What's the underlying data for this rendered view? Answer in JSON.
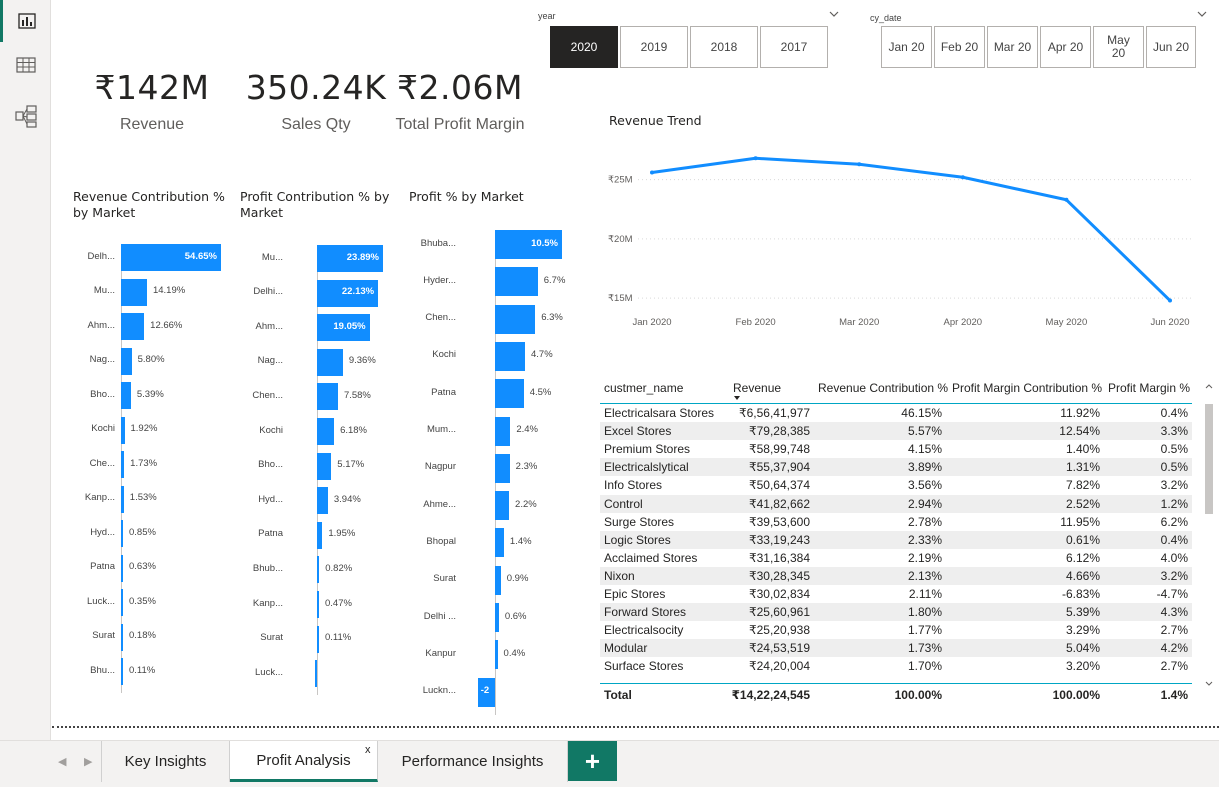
{
  "colors": {
    "accent": "#118dff",
    "tab_accent": "#117865",
    "selected_tile": "#252423",
    "line": "#118dff"
  },
  "rail": {
    "icons": [
      "report-icon",
      "table-icon",
      "model-icon"
    ]
  },
  "slicers": {
    "year": {
      "title": "year",
      "options": [
        "2020",
        "2019",
        "2018",
        "2017"
      ],
      "selected": "2020"
    },
    "cy_date": {
      "title": "cy_date",
      "options": [
        "Jan 20",
        "Feb 20",
        "Mar 20",
        "Apr 20",
        "May 20",
        "Jun 20"
      ]
    }
  },
  "kpis": [
    {
      "value": "₹142M",
      "label": "Revenue"
    },
    {
      "value": "350.24K",
      "label": "Sales Qty"
    },
    {
      "value": "₹2.06M",
      "label": "Total Profit Margin"
    }
  ],
  "bar_charts": [
    {
      "title_line1": "Revenue Contribution %",
      "title_line2": "by Market",
      "categories": [
        "Delh...",
        "Mu...",
        "Ahm...",
        "Nag...",
        "Bho...",
        "Kochi",
        "Che...",
        "Kanp...",
        "Hyd...",
        "Patna",
        "Luck...",
        "Surat",
        "Bhu..."
      ],
      "values": [
        54.65,
        14.19,
        12.66,
        5.8,
        5.39,
        1.92,
        1.73,
        1.53,
        0.85,
        0.63,
        0.35,
        0.18,
        0.11
      ],
      "labels": [
        "54.65%",
        "14.19%",
        "12.66%",
        "5.80%",
        "5.39%",
        "1.92%",
        "1.73%",
        "1.53%",
        "0.85%",
        "0.63%",
        "0.35%",
        "0.18%",
        "0.11%"
      ]
    },
    {
      "title_line1": "Profit Contribution % by",
      "title_line2": "Market",
      "categories": [
        "Mu...",
        "Delhi...",
        "Ahm...",
        "Nag...",
        "Chen...",
        "Kochi",
        "Bho...",
        "Hyd...",
        "Patna",
        "Bhub...",
        "Kanp...",
        "Surat",
        "Luck..."
      ],
      "values": [
        23.89,
        22.13,
        19.05,
        9.36,
        7.58,
        6.18,
        5.17,
        3.94,
        1.95,
        0.82,
        0.47,
        0.11,
        -0.3
      ],
      "labels": [
        "23.89%",
        "22.13%",
        "19.05%",
        "9.36%",
        "7.58%",
        "6.18%",
        "5.17%",
        "3.94%",
        "1.95%",
        "0.82%",
        "0.47%",
        "0.11%",
        ""
      ]
    },
    {
      "title_line1": "Profit % by Market",
      "title_line2": "",
      "categories": [
        "Bhuba...",
        "Hyder...",
        "Chen...",
        "Kochi",
        "Patna",
        "Mum...",
        "Nagpur",
        "Ahme...",
        "Bhopal",
        "Surat",
        "Delhi ...",
        "Kanpur",
        "Luckn..."
      ],
      "values": [
        10.5,
        6.7,
        6.3,
        4.7,
        4.5,
        2.4,
        2.3,
        2.2,
        1.4,
        0.9,
        0.6,
        0.4,
        -2.7
      ],
      "labels": [
        "10.5%",
        "6.7%",
        "6.3%",
        "4.7%",
        "4.5%",
        "2.4%",
        "2.3%",
        "2.2%",
        "1.4%",
        "0.9%",
        "0.6%",
        "0.4%",
        "-2"
      ]
    }
  ],
  "chart_data": {
    "type": "line",
    "title": "Revenue Trend",
    "x": [
      "Jan 2020",
      "Feb 2020",
      "Mar 2020",
      "Apr 2020",
      "May 2020",
      "Jun 2020"
    ],
    "values": [
      25.6,
      26.8,
      26.3,
      25.2,
      23.3,
      14.8
    ],
    "y_ticks": [
      "₹15M",
      "₹20M",
      "₹25M"
    ],
    "ylim": [
      14,
      27.5
    ],
    "grid": true
  },
  "table": {
    "columns": [
      "custmer_name",
      "Revenue",
      "Revenue Contribution %",
      "Profit Margin Contribution %",
      "Profit Margin %"
    ],
    "rows": [
      [
        "Electricalsara Stores",
        "₹6,56,41,977",
        "46.15%",
        "11.92%",
        "0.4%"
      ],
      [
        "Excel Stores",
        "₹79,28,385",
        "5.57%",
        "12.54%",
        "3.3%"
      ],
      [
        "Premium Stores",
        "₹58,99,748",
        "4.15%",
        "1.40%",
        "0.5%"
      ],
      [
        "Electricalslytical",
        "₹55,37,904",
        "3.89%",
        "1.31%",
        "0.5%"
      ],
      [
        "Info Stores",
        "₹50,64,374",
        "3.56%",
        "7.82%",
        "3.2%"
      ],
      [
        "Control",
        "₹41,82,662",
        "2.94%",
        "2.52%",
        "1.2%"
      ],
      [
        "Surge Stores",
        "₹39,53,600",
        "2.78%",
        "11.95%",
        "6.2%"
      ],
      [
        "Logic Stores",
        "₹33,19,243",
        "2.33%",
        "0.61%",
        "0.4%"
      ],
      [
        "Acclaimed Stores",
        "₹31,16,384",
        "2.19%",
        "6.12%",
        "4.0%"
      ],
      [
        "Nixon",
        "₹30,28,345",
        "2.13%",
        "4.66%",
        "3.2%"
      ],
      [
        "Epic Stores",
        "₹30,02,834",
        "2.11%",
        "-6.83%",
        "-4.7%"
      ],
      [
        "Forward Stores",
        "₹25,60,961",
        "1.80%",
        "5.39%",
        "4.3%"
      ],
      [
        "Electricalsocity",
        "₹25,20,938",
        "1.77%",
        "3.29%",
        "2.7%"
      ],
      [
        "Modular",
        "₹24,53,519",
        "1.73%",
        "5.04%",
        "4.2%"
      ],
      [
        "Surface Stores",
        "₹24,20,004",
        "1.70%",
        "3.20%",
        "2.7%"
      ]
    ],
    "total": [
      "Total",
      "₹14,22,24,545",
      "100.00%",
      "100.00%",
      "1.4%"
    ]
  },
  "tabs": {
    "items": [
      "Key Insights",
      "Profit Analysis",
      "Performance Insights"
    ],
    "active": "Profit Analysis",
    "close_label": "x",
    "add_label": "+"
  }
}
